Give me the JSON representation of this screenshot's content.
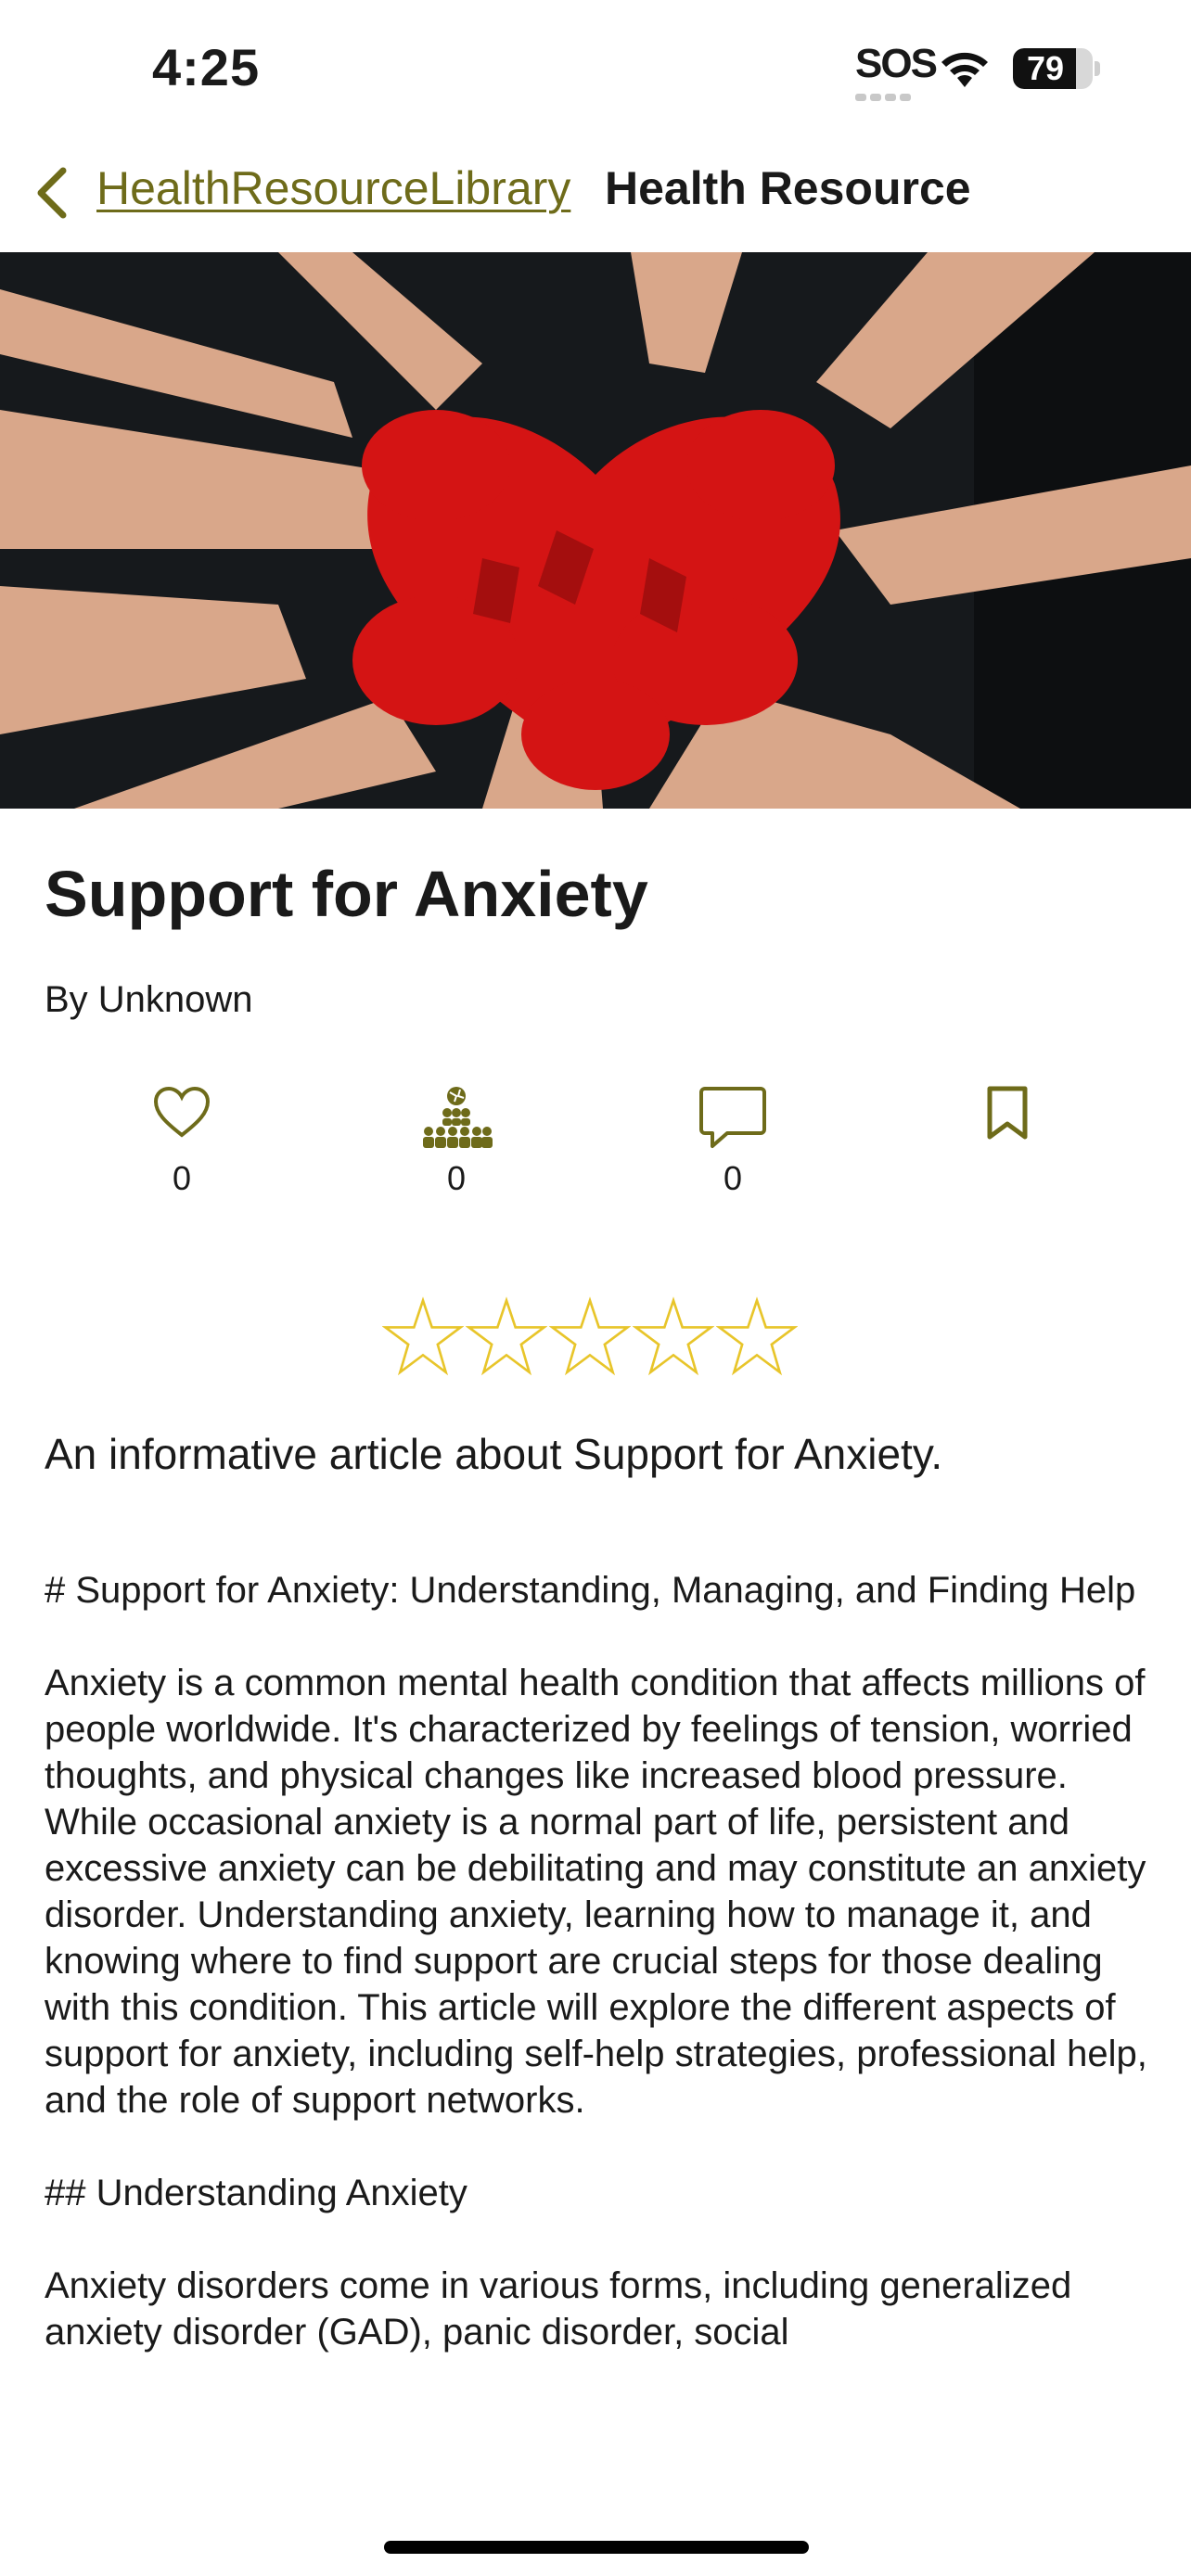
{
  "status_bar": {
    "time": "4:25",
    "sos": "SOS",
    "battery": "79",
    "battery_level": 0.79,
    "icons": [
      "wifi-icon",
      "battery-icon"
    ]
  },
  "nav": {
    "back_label": "HealthResourceLibrary",
    "title": "Health Resource",
    "back_icon": "chevron-left-icon",
    "accent_color": "#6e6b1a"
  },
  "hero": {
    "icon": "hero-image-hands-heart"
  },
  "article": {
    "title": "Support for Anxiety",
    "author": "By Unknown",
    "actions": [
      {
        "icon": "heart-icon",
        "count": "0"
      },
      {
        "icon": "community-icon",
        "count": "0"
      },
      {
        "icon": "comment-icon",
        "count": "0"
      },
      {
        "icon": "bookmark-icon"
      }
    ],
    "rating": {
      "value": 0,
      "max": 5,
      "star_color": "#e8c52a"
    },
    "summary": "An informative article about Support for Anxiety.",
    "body": [
      "# Support for Anxiety: Understanding, Managing, and Finding Help",
      "Anxiety is a common mental health condition that affects millions of people worldwide. It's characterized by feelings of tension, worried thoughts, and physical changes like increased blood pressure. While occasional anxiety is a normal part of life, persistent and excessive anxiety can be debilitating and may constitute an anxiety disorder. Understanding anxiety, learning how to manage it, and knowing where to find support are crucial steps for those dealing with this condition. This article will explore the different aspects of support for anxiety, including self-help strategies, professional help, and the role of support networks.",
      "## Understanding Anxiety",
      "Anxiety disorders come in various forms, including generalized anxiety disorder (GAD), panic disorder, social"
    ]
  }
}
